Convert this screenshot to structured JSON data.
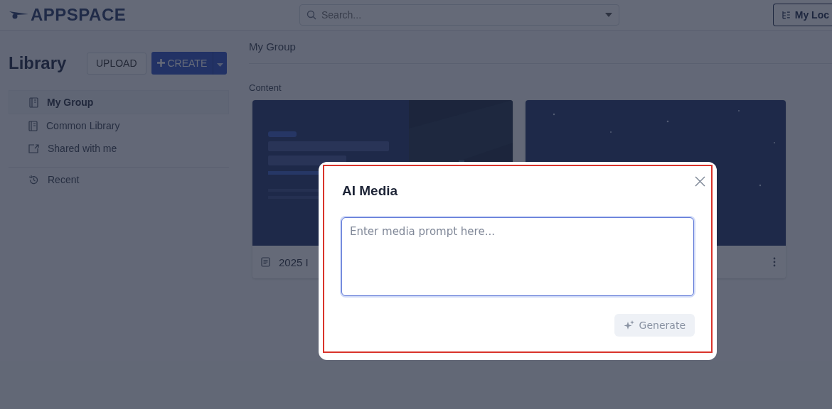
{
  "header": {
    "logo": "APPSPACE",
    "search": {
      "placeholder": "Search..."
    },
    "location_button": "My Loc"
  },
  "sidebar": {
    "title": "Library",
    "upload_button": "UPLOAD",
    "create_button": "CREATE",
    "items": [
      {
        "label": "My Group",
        "kind": "library",
        "selected": true
      },
      {
        "label": "Common Library",
        "kind": "library",
        "selected": false
      },
      {
        "label": "Shared with me",
        "kind": "shared",
        "selected": false
      },
      {
        "label": "Recent",
        "kind": "recent",
        "selected": false
      }
    ]
  },
  "main": {
    "breadcrumb": "My Group",
    "section_title": "Content",
    "cards": [
      {
        "kind": "slide",
        "title": "2025 I",
        "menu": false
      },
      {
        "kind": "picture",
        "menu": true
      }
    ]
  },
  "dialog": {
    "title": "AI Media",
    "prompt": {
      "placeholder": "Enter media prompt here..."
    },
    "generate_button": "Generate",
    "generate_disabled": true,
    "highlighted": true
  }
}
